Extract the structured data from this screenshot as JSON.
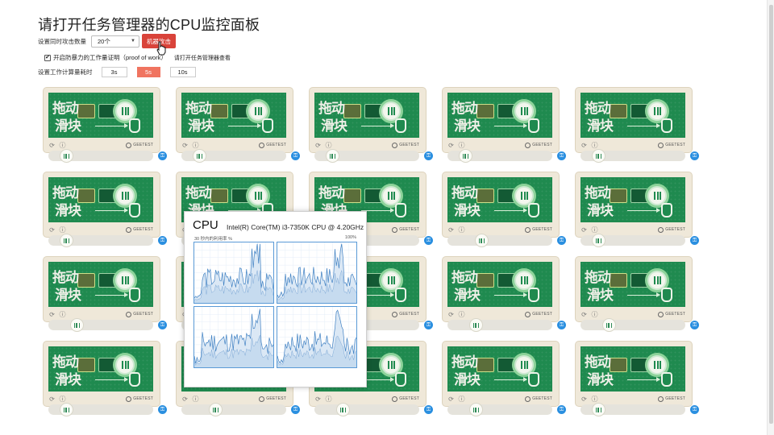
{
  "page": {
    "title": "请打开任务管理器的CPU监控面板",
    "concurrency_label": "设置同时攻击数量",
    "concurrency_value": "20个",
    "attack_button": "机器攻击",
    "pow_checkbox_label": "开启防暴力的工作量证明（proof of work）",
    "pow_checked": true,
    "hint": "请打开任务管理器查看",
    "work_time_label": "设置工作计算量耗时",
    "time_options": [
      "3s",
      "5s",
      "10s"
    ],
    "time_selected": "5s"
  },
  "captcha": {
    "prompt_line1": "拖动",
    "prompt_line2": "滑块",
    "brand": "GEETEST",
    "refresh_icon": "refresh-icon",
    "info_icon": "info-icon",
    "lock_icon": "lock-icon",
    "count": 20,
    "slider_levels": [
      0.12,
      0.12,
      0.12,
      0.12,
      0.12,
      0.12,
      0.3,
      0.12,
      0.3,
      0.12,
      0.24,
      0.24,
      0.24,
      0.24,
      0.24,
      0.12,
      0.3,
      0.24,
      0.24,
      0.12
    ]
  },
  "task_manager": {
    "heading": "CPU",
    "model": "Intel(R) Core(TM) i3-7350K CPU @ 4.20GHz",
    "subtitle": "30 秒内的利用率 %",
    "max_label": "100%",
    "accent": "#5a9ad6"
  }
}
